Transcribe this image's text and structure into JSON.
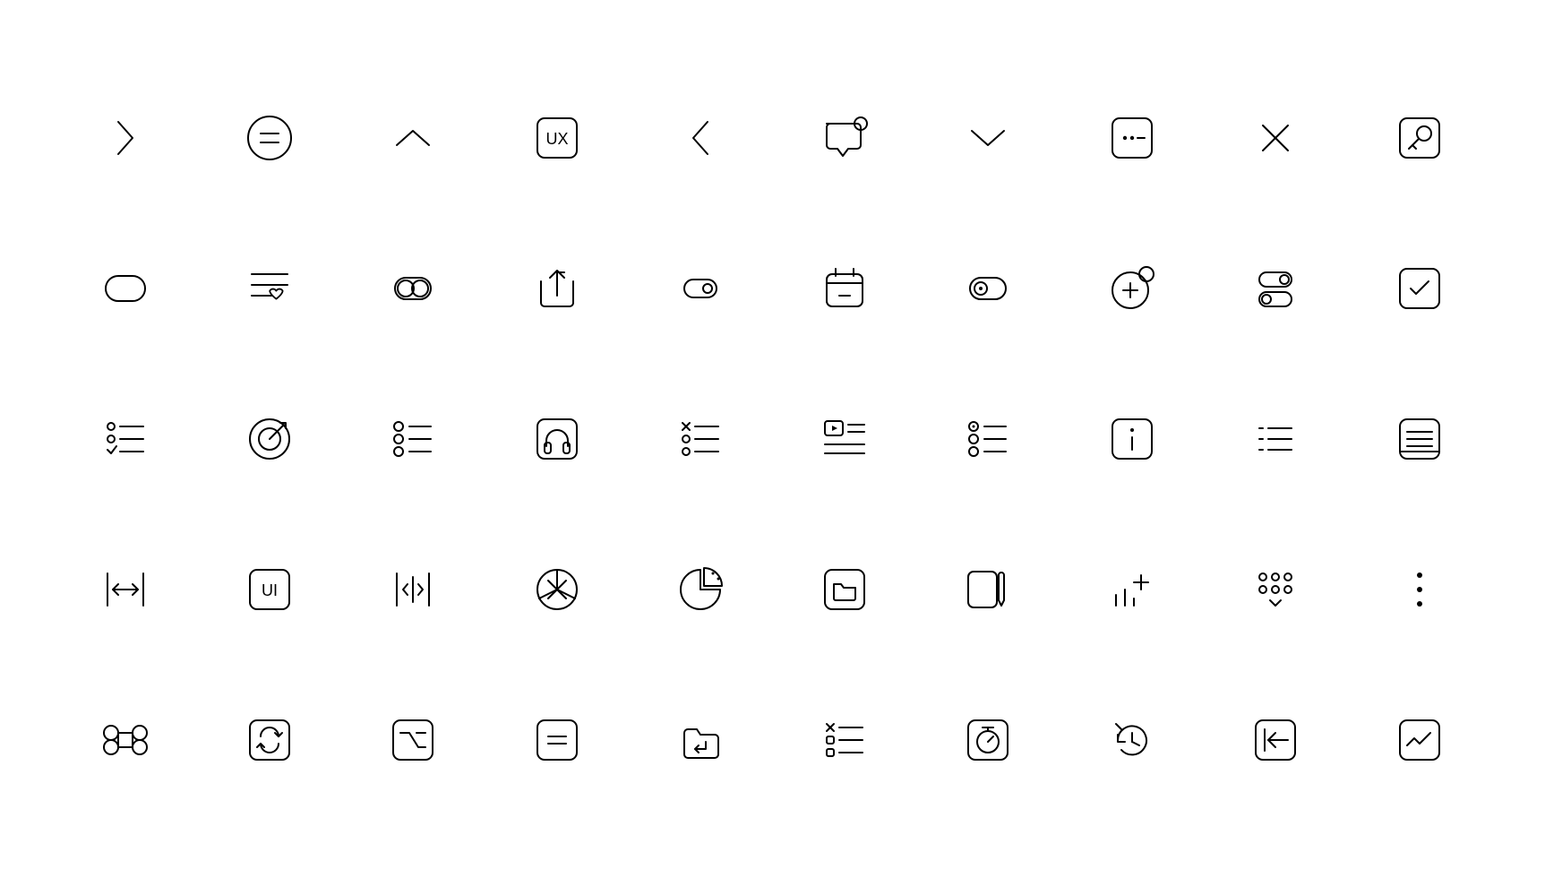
{
  "type": "icon-grid",
  "grid_cols": 10,
  "grid_rows": 5,
  "stroke_color": "#000000",
  "background": "#ffffff",
  "icons": [
    [
      "chevron-right",
      "equals-circle",
      "chevron-up",
      "ux-box",
      "chevron-left",
      "chat-notification",
      "chevron-down",
      "password-box",
      "close",
      "key-box"
    ],
    [
      "toggle-double",
      "favorite-list",
      "toggle-pair",
      "share-box",
      "toggle-on",
      "calendar-remove",
      "toggle-dot",
      "add-notification-circle",
      "dual-toggle",
      "checkbox"
    ],
    [
      "checklist",
      "target",
      "bullet-list",
      "headphones-box",
      "remove-list",
      "video-text",
      "radio-list",
      "info-box",
      "menu-lines",
      "text-box"
    ],
    [
      "width-constrain",
      "ui-box",
      "code-split",
      "aperture-circle",
      "pie-chart",
      "folder-box",
      "edit-panel",
      "add-chart",
      "dialpad",
      "more-vertical"
    ],
    [
      "command",
      "repeat-box",
      "option-key-box",
      "equals-box",
      "enter-folder",
      "task-list",
      "timer-box",
      "history",
      "back-box",
      "trend-box"
    ]
  ],
  "labels": {
    "ux": "UX",
    "ui": "UI"
  }
}
